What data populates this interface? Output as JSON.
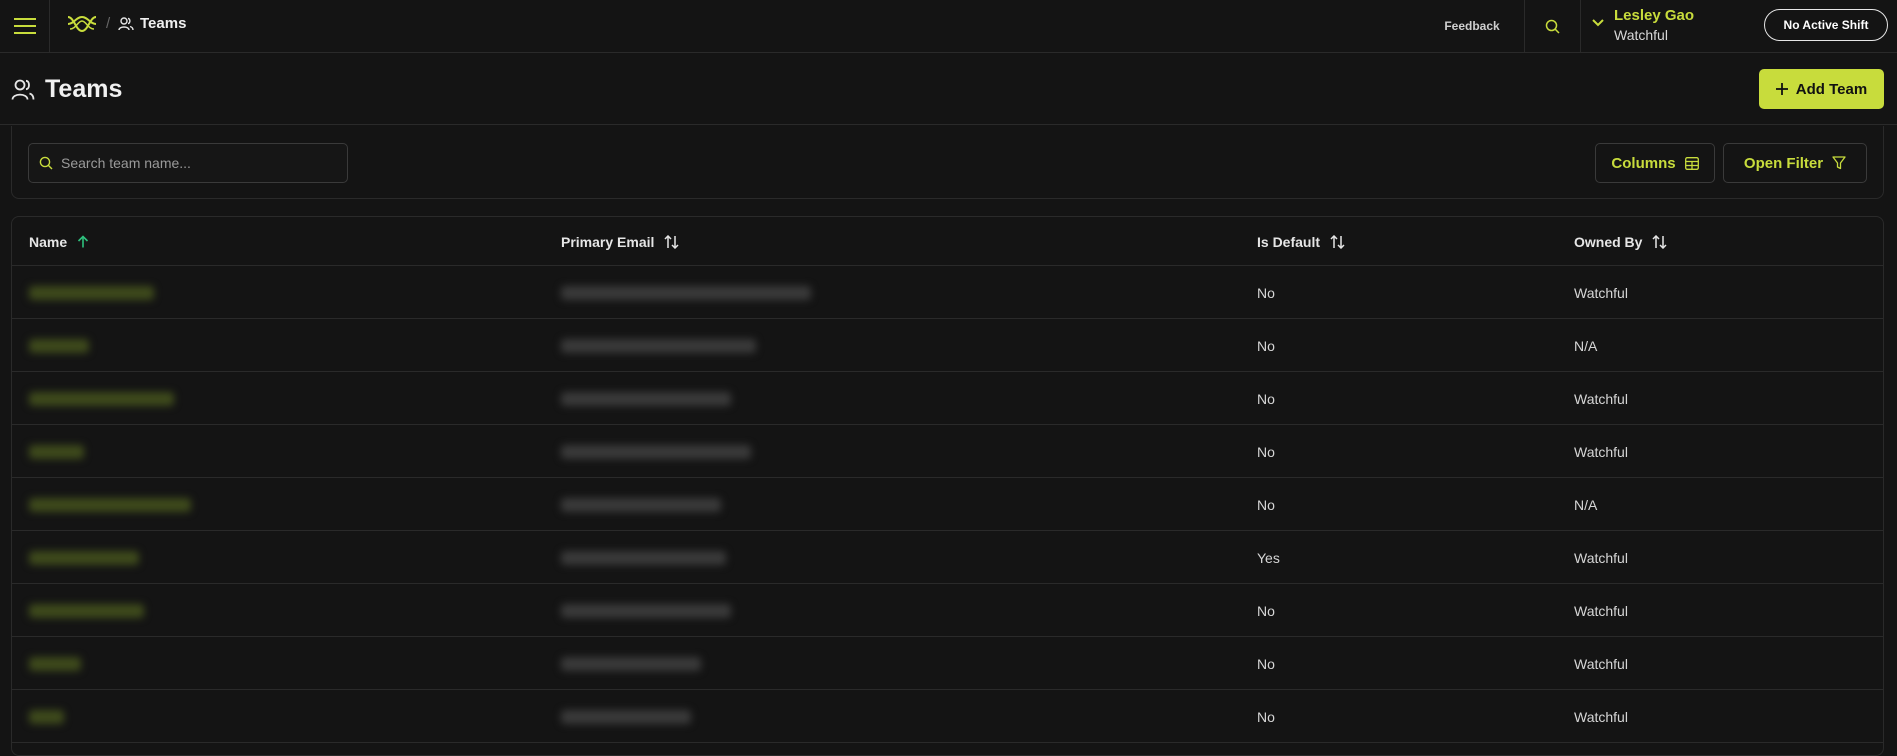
{
  "topbar": {
    "breadcrumb_separator": "/",
    "breadcrumb_label": "Teams",
    "feedback_label": "Feedback",
    "user_name": "Lesley Gao",
    "user_org": "Watchful",
    "shift_label": "No Active Shift"
  },
  "page": {
    "title": "Teams",
    "add_button_label": "Add Team"
  },
  "toolbar": {
    "search_placeholder": "Search team name...",
    "search_value": "",
    "columns_label": "Columns",
    "filter_label": "Open Filter"
  },
  "table": {
    "headers": {
      "name": "Name",
      "primary_email": "Primary Email",
      "is_default": "Is Default",
      "owned_by": "Owned By"
    },
    "sort": {
      "name": "ascending"
    },
    "rows": [
      {
        "name_redacted": true,
        "email_redacted": true,
        "is_default": "No",
        "owned_by": "Watchful"
      },
      {
        "name_redacted": true,
        "email_redacted": true,
        "is_default": "No",
        "owned_by": "N/A"
      },
      {
        "name_redacted": true,
        "email_redacted": true,
        "is_default": "No",
        "owned_by": "Watchful"
      },
      {
        "name_redacted": true,
        "email_redacted": true,
        "is_default": "No",
        "owned_by": "Watchful"
      },
      {
        "name_redacted": true,
        "email_redacted": true,
        "is_default": "No",
        "owned_by": "N/A"
      },
      {
        "name_redacted": true,
        "email_redacted": true,
        "is_default": "Yes",
        "owned_by": "Watchful"
      },
      {
        "name_redacted": true,
        "email_redacted": true,
        "is_default": "No",
        "owned_by": "Watchful"
      },
      {
        "name_redacted": true,
        "email_redacted": true,
        "is_default": "No",
        "owned_by": "Watchful"
      },
      {
        "name_redacted": true,
        "email_redacted": true,
        "is_default": "No",
        "owned_by": "Watchful"
      }
    ]
  },
  "icons": {
    "menu": "hamburger-icon",
    "logo": "watchful-logo",
    "teams": "users-icon",
    "search": "search-icon",
    "chevron": "chevron-down-icon",
    "plus": "plus-icon",
    "columns": "table-grid-icon",
    "filter": "funnel-icon",
    "sort_asc": "arrow-up-icon",
    "sort_both": "sort-arrows-icon"
  },
  "colors": {
    "accent": "#c8dc3c",
    "background": "#141414",
    "border": "#2a2a2a",
    "sort_active": "#2ec27e"
  }
}
